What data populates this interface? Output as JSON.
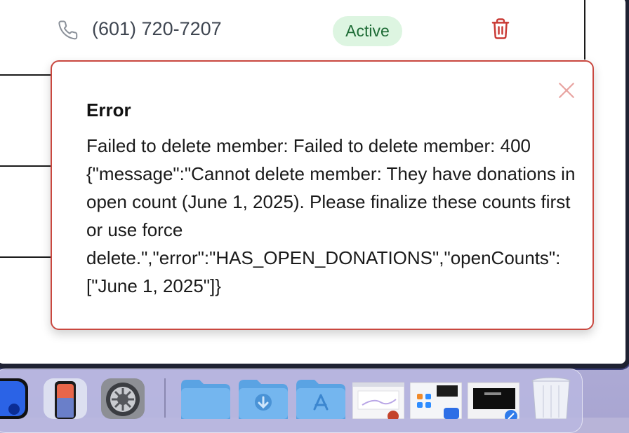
{
  "member_row": {
    "phone": "(601) 720-7207",
    "status": "Active"
  },
  "toast": {
    "title": "Error",
    "message": "Failed to delete member: Failed to delete member: 400 {\"message\":\"Cannot delete member: They have donations in open count (June 1, 2025). Please finalize these counts first or use force delete.\",\"error\":\"HAS_OPEN_DONATIONS\",\"openCounts\":[\"June 1, 2025\"]}"
  },
  "dock": {
    "items": [
      {
        "icon": "facetime-app-icon"
      },
      {
        "icon": "iphone-mirroring-app-icon"
      },
      {
        "icon": "system-settings-app-icon"
      },
      {
        "icon": "folder-icon"
      },
      {
        "icon": "downloads-folder-icon"
      },
      {
        "icon": "applications-folder-icon"
      },
      {
        "icon": "powerpoint-window-thumbnail"
      },
      {
        "icon": "zoom-window-thumbnail"
      },
      {
        "icon": "safari-window-thumbnail"
      },
      {
        "icon": "trash-icon"
      }
    ]
  },
  "colors": {
    "status_bg": "#ddf5e1",
    "status_text": "#1d6b35",
    "danger": "#c9473f",
    "trash_red": "#c93a35"
  }
}
